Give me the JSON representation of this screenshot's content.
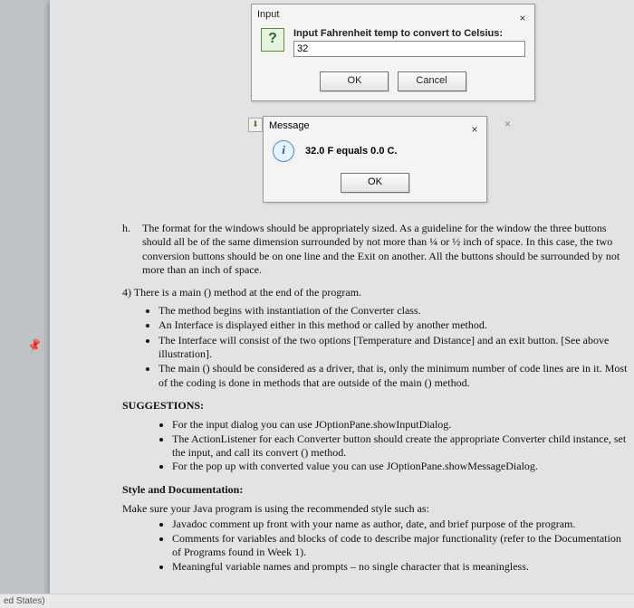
{
  "bottombar": {
    "text": "ed States)"
  },
  "dialog1": {
    "title": "Input",
    "close": "×",
    "icon_glyph": "?",
    "prompt": "Input Fahrenheit temp to convert to Celsius:",
    "input_value": "32",
    "ok": "OK",
    "cancel": "Cancel"
  },
  "dialog2": {
    "title": "Message",
    "close": "×",
    "shadow_close": "×",
    "icon_glyph": "i",
    "message": "32.0 F equals 0.0 C.",
    "ok": "OK",
    "mini_icon": "⬇"
  },
  "doc": {
    "h_marker": "h.",
    "h_text": "The format for the windows should be appropriately sized. As a guideline for the window the three buttons should all be of the same dimension surrounded by not more than ¼ or ½ inch of space. In this case, the two conversion buttons should be on one line and the Exit on another. All the buttons should be surrounded by not more than an inch of space.",
    "four_intro": "4) There is a main () method at the end of the program.",
    "four_bullets": [
      "The method begins with instantiation of the Converter class.",
      "An Interface is displayed either in this method or called by another method.",
      "The Interface will consist of the two options [Temperature and Distance] and an exit button. [See above illustration].",
      "The main () should be considered as a driver, that is, only the minimum number of code lines are in it. Most of the coding is done in methods that are outside of the main () method."
    ],
    "suggestions_head": "SUGGESTIONS:",
    "suggestions": [
      "For the input dialog you can use JOptionPane.showInputDialog.",
      "The ActionListener for each Converter button should create the appropriate Converter child instance, set the input, and call its convert () method.",
      "For the pop up with converted value you can use JOptionPane.showMessageDialog."
    ],
    "style_head": "Style and Documentation:",
    "style_intro": "Make sure your Java program is using the recommended style such as:",
    "style_bullets": [
      "Javadoc comment up front with your name as author, date, and brief purpose of the program.",
      "Comments for variables and blocks of code to describe major functionality (refer to the Documentation of Programs found in Week 1).",
      "Meaningful variable names and prompts – no single character that is meaningless."
    ]
  }
}
